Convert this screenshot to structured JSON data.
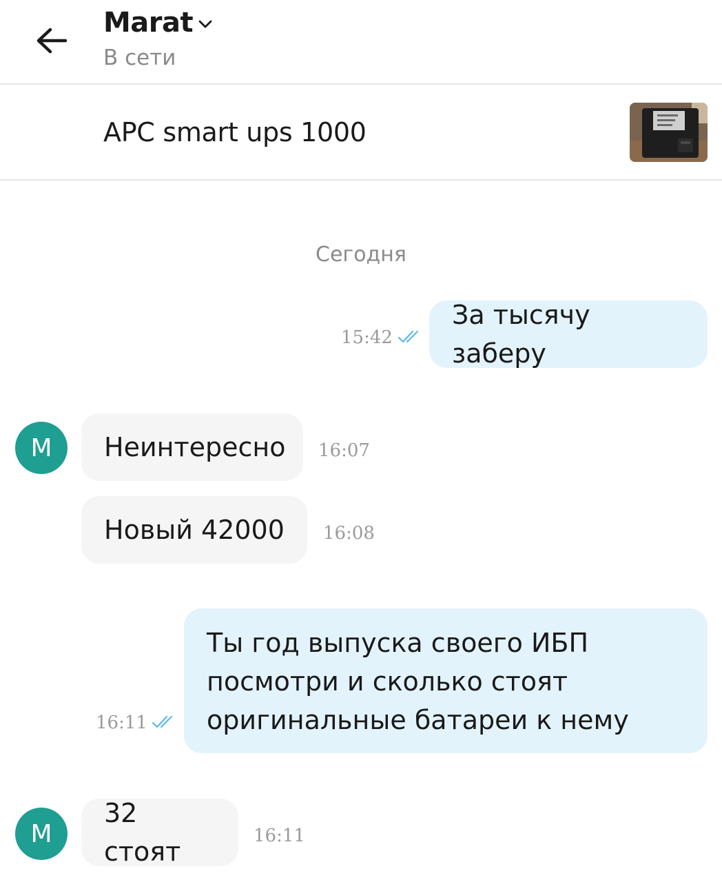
{
  "header": {
    "contact_name": "Marat",
    "status": "В сети"
  },
  "product": {
    "title": "APC smart ups 1000"
  },
  "chat": {
    "date_separator": "Сегодня",
    "messages": [
      {
        "direction": "out",
        "text": "За тысячу заберу",
        "time": "15:42",
        "read": true
      },
      {
        "direction": "in",
        "avatar": "M",
        "text": "Неинтересно",
        "time": "16:07"
      },
      {
        "direction": "in",
        "text": "Новый 42000",
        "time": "16:08"
      },
      {
        "direction": "out",
        "text": "Ты год выпуска своего ИБП\nпосмотри и сколько стоят\nоригинальные батареи к нему",
        "time": "16:11",
        "read": true
      },
      {
        "direction": "in",
        "avatar": "M",
        "text": "32 стоят",
        "time": "16:11"
      }
    ]
  },
  "colors": {
    "outgoing_bubble": "#e3f3fc",
    "incoming_bubble": "#f5f5f5",
    "avatar": "#1f9e92",
    "read_checks": "#5bb8e8"
  },
  "icons": {
    "back": "arrow-left-icon",
    "dropdown": "chevron-down-icon",
    "read_status": "double-check-icon"
  }
}
